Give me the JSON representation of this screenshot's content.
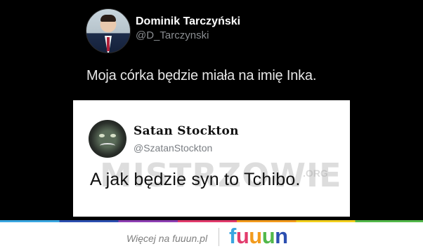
{
  "tweet": {
    "author_name": "Dominik Tarczyński",
    "author_handle": "@D_Tarczynski",
    "text": "Moja córka będzie miała na imię Inka."
  },
  "reply": {
    "author_name": "Satan Stockton",
    "author_handle": "@SzatanStockton",
    "text": "A jak będzie syn to Tchibo."
  },
  "watermark": {
    "text": "MISTRZOWIE",
    "suffix": ".ORG"
  },
  "footer": {
    "link_text": "Więcej na fuuun.pl",
    "brand_letters": [
      "f",
      "u",
      "u",
      "u",
      "n"
    ],
    "brand_colors": [
      "#3aa6e0",
      "#e23b6c",
      "#f29b1d",
      "#52b84a",
      "#2c4fb0"
    ]
  }
}
